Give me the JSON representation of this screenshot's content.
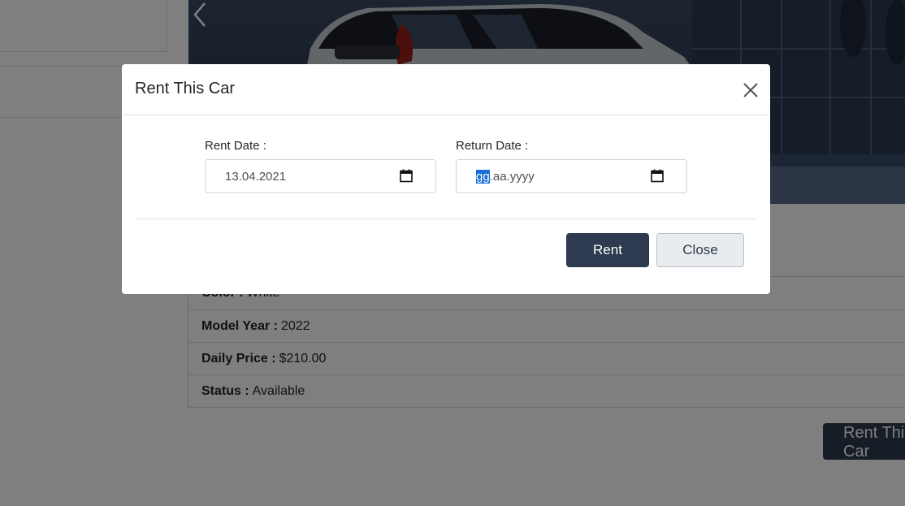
{
  "page": {
    "car_details": [
      {
        "label": "Color :",
        "value": "White"
      },
      {
        "label": "Model Year :",
        "value": "2022"
      },
      {
        "label": "Daily Price :",
        "value": "$210.00"
      },
      {
        "label": "Status :",
        "value": "Available"
      }
    ],
    "rent_this_car_button": "Rent This Car",
    "carousel_prev_icon": "chevron-left-icon"
  },
  "modal": {
    "title": "Rent This Car",
    "close_icon": "close-icon",
    "rent_date": {
      "label": "Rent Date :",
      "value": "13.04.2021",
      "icon": "calendar-icon"
    },
    "return_date": {
      "label": "Return Date :",
      "selected_segment": "gg",
      "rest": ".aa.yyyy",
      "icon": "calendar-icon"
    },
    "rent_button": "Rent",
    "close_button": "Close"
  },
  "colors": {
    "primary": "#2d3a4f",
    "selection": "#1a6fd6",
    "overlay": "rgba(0,0,0,0.5)"
  }
}
